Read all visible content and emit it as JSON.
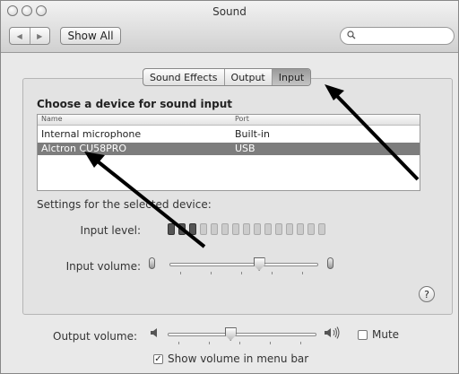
{
  "window": {
    "title": "Sound"
  },
  "toolbar": {
    "back_glyph": "◀",
    "forward_glyph": "▶",
    "show_all_label": "Show All",
    "search_icon": "magnifier-icon"
  },
  "tabs": [
    {
      "label": "Sound Effects",
      "active": false
    },
    {
      "label": "Output",
      "active": false
    },
    {
      "label": "Input",
      "active": true
    }
  ],
  "input": {
    "section_title": "Choose a device for sound input",
    "columns": {
      "name": "Name",
      "port": "Port"
    },
    "devices": [
      {
        "name": "Internal microphone",
        "port": "Built-in",
        "selected": false
      },
      {
        "name": "Alctron CU58PRO",
        "port": "USB",
        "selected": true
      }
    ],
    "settings_label": "Settings for the selected device:",
    "input_level_label": "Input level:",
    "input_level_active_segments": 3,
    "input_level_total_segments": 15,
    "input_volume_label": "Input volume:",
    "input_volume_value": 0.6
  },
  "help_glyph": "?",
  "output": {
    "volume_label": "Output volume:",
    "volume_value": 0.42,
    "mute_label": "Mute",
    "mute_checked": false,
    "show_in_menubar_label": "Show volume in menu bar",
    "show_in_menubar_checked": true,
    "check_glyph": "✓"
  },
  "colors": {
    "selected_row": "#7d7d7d",
    "arrow": "#000000"
  }
}
